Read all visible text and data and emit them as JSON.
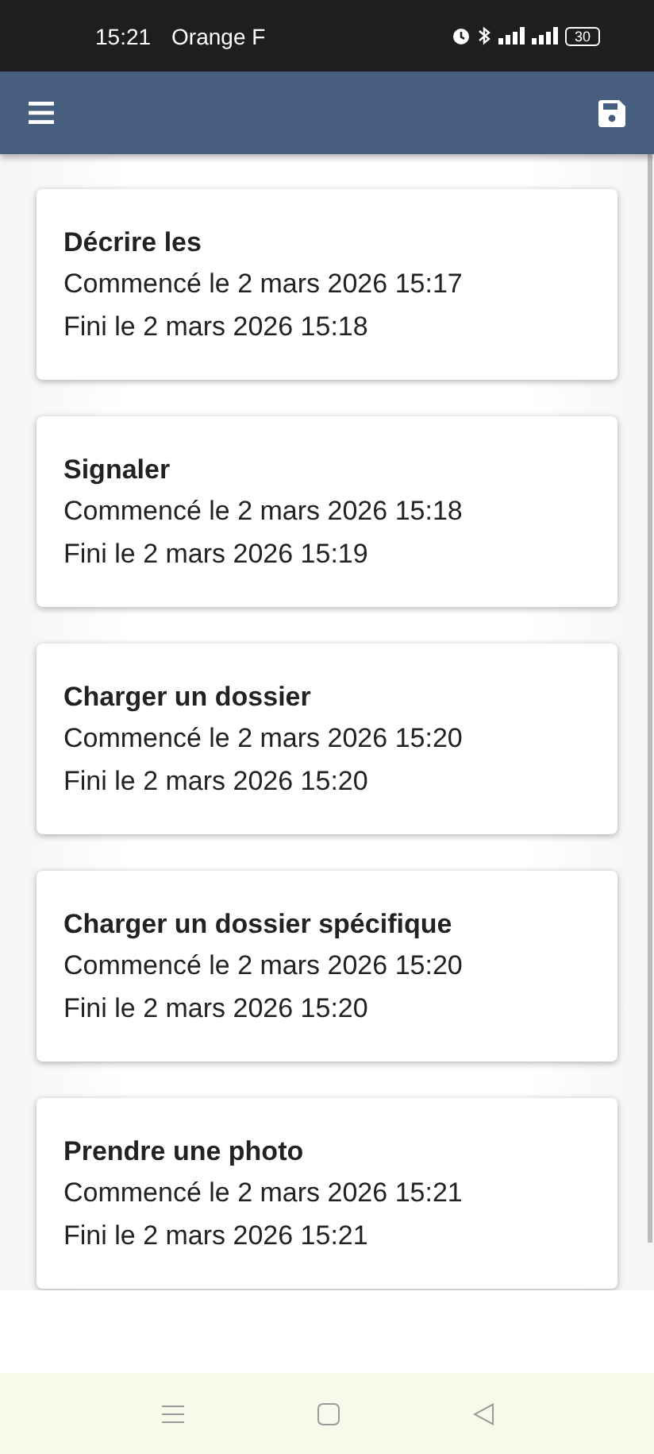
{
  "status_bar": {
    "time": "15:21",
    "carrier": "Orange F",
    "battery": "30"
  },
  "cards": [
    {
      "title": "Décrire les",
      "started": "Commencé le 2 mars 2026 15:17",
      "finished": "Fini le 2 mars 2026 15:18"
    },
    {
      "title": "Signaler",
      "started": "Commencé le 2 mars 2026 15:18",
      "finished": "Fini le 2 mars 2026 15:19"
    },
    {
      "title": "Charger un dossier",
      "started": "Commencé le 2 mars 2026 15:20",
      "finished": "Fini le 2 mars 2026 15:20"
    },
    {
      "title": "Charger un dossier spécifique",
      "started": "Commencé le 2 mars 2026 15:20",
      "finished": "Fini le 2 mars 2026 15:20"
    },
    {
      "title": "Prendre une photo",
      "started": "Commencé le 2 mars 2026 15:21",
      "finished": "Fini le 2 mars 2026 15:21"
    }
  ]
}
